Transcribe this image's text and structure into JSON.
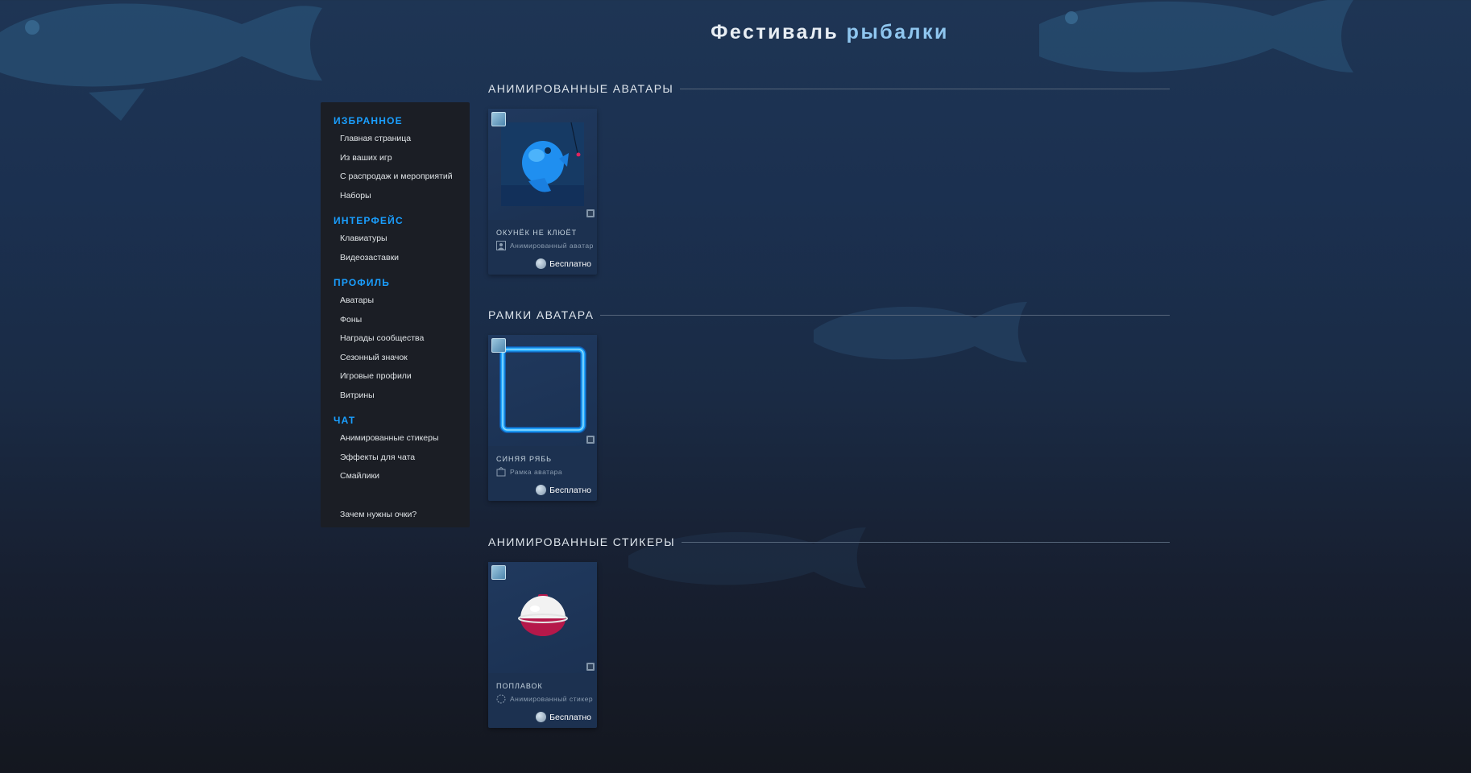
{
  "header": {
    "title_part1": "Фестиваль",
    "title_part2": "рыбалки"
  },
  "sidebar": {
    "groups": [
      {
        "heading": "Избранное",
        "items": [
          "Главная страница",
          "Из ваших игр",
          "С распродаж и мероприятий",
          "Наборы"
        ]
      },
      {
        "heading": "Интерфейс",
        "items": [
          "Клавиатуры",
          "Видеозаставки"
        ]
      },
      {
        "heading": "Профиль",
        "items": [
          "Аватары",
          "Фоны",
          "Награды сообщества",
          "Сезонный значок",
          "Игровые профили",
          "Витрины"
        ]
      },
      {
        "heading": "Чат",
        "items": [
          "Анимированные стикеры",
          "Эффекты для чата",
          "Смайлики"
        ]
      }
    ],
    "footer_link": "Зачем нужны очки?"
  },
  "sections": [
    {
      "title": "АНИМИРОВАННЫЕ АВАТАРЫ",
      "card": {
        "name": "ОКУНЁК НЕ КЛЮЁТ",
        "type": "Анимированный аватар",
        "price": "Бесплатно"
      }
    },
    {
      "title": "РАМКИ АВАТАРА",
      "card": {
        "name": "СИНЯЯ РЯБЬ",
        "type": "Рамка аватара",
        "price": "Бесплатно"
      }
    },
    {
      "title": "АНИМИРОВАННЫЕ СТИКЕРЫ",
      "card": {
        "name": "ПОПЛАВОК",
        "type": "Анимированный стикер",
        "price": "Бесплатно"
      }
    }
  ],
  "colors": {
    "accent": "#1a9fff",
    "title_accent": "#8fc6ef",
    "sidebar_bg": "#1b1e25",
    "card_bg": "#1c3150"
  },
  "icons": [
    "fish-icon",
    "avatar-type-icon",
    "frame-type-icon",
    "sticker-type-icon",
    "points-coin-icon"
  ]
}
